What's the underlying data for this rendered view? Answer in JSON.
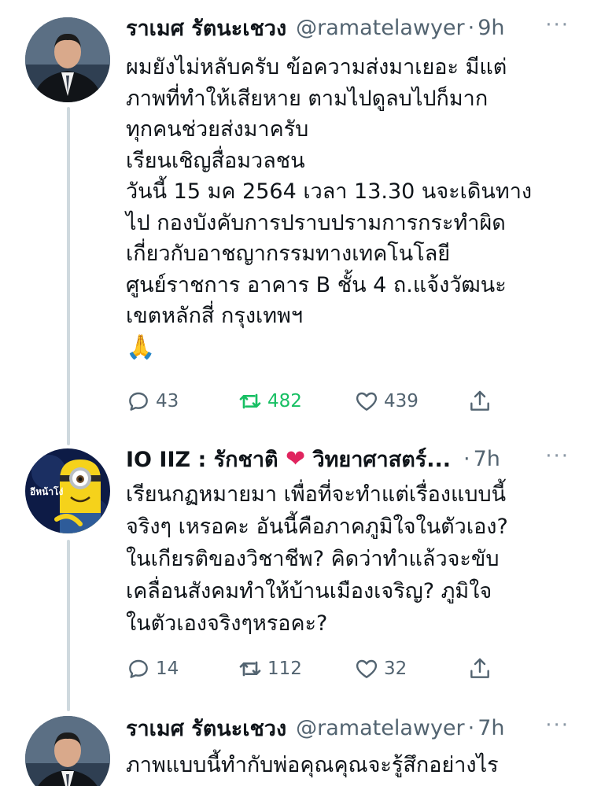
{
  "tweets": [
    {
      "name": "ราเมศ รัตนะเชวง",
      "handle": "@ramatelawyer",
      "separator": "·",
      "time": "9h",
      "more": "···",
      "lines": [
        "ผมยังไม่หลับครับ ข้อความส่งมาเยอะ มีแต่",
        "ภาพที่ทำให้เสียหาย ตามไปดูลบไปก็มาก",
        "ทุกคนช่วยส่งมาครับ",
        "เรียนเชิญสื่อมวลชน",
        "วันนี้ 15 มค 2564 เวลา 13.30 นจะเดินทาง",
        "ไป กองบังคับการปราบปรามการกระทำผิด",
        "เกี่ยวกับอาชญากรรมทางเทคโนโลยี",
        "ศูนย์ราชการ อาคาร B ชั้น 4 ถ.แจ้งวัฒนะ",
        "เขตหลักสี่ กรุงเทพฯ",
        "🙏"
      ],
      "replies": "43",
      "retweets": "482",
      "likes": "439"
    },
    {
      "name": "IO IIZ : รักชาติ ❤️ วิทยาศาสตร์...",
      "handle": "",
      "separator": "·",
      "time": "7h",
      "more": "···",
      "avatar_text": "อีหน้าโง่",
      "lines": [
        "เรียนกฏหมายมา เพื่อที่จะทำแต่เรื่องแบบนี้",
        "จริงๆ เหรอคะ อันนี้คือภาคภูมิใจในตัวเอง?",
        "ในเกียรติของวิชาชีพ? คิดว่าทำแล้วจะขับ",
        "เคลื่อนสังคมทำให้บ้านเมืองเจริญ? ภูมิใจ",
        "ในตัวเองจริงๆหรอคะ?"
      ],
      "replies": "14",
      "retweets": "112",
      "likes": "32"
    },
    {
      "name": "ราเมศ รัตนะเชวง",
      "handle": "@ramatelawyer",
      "separator": "·",
      "time": "7h",
      "more": "···",
      "lines": [
        "ภาพแบบนี้ทำกับพ่อคุณคุณจะรู้สึกอย่างไร"
      ]
    }
  ],
  "icons": {
    "reply": "reply-icon",
    "retweet": "retweet-icon",
    "like": "heart-icon",
    "share": "share-icon"
  },
  "colors": {
    "text": "#0f1419",
    "secondary": "#536471",
    "retweet_active": "#17bf63",
    "thread_line": "#cfd9de"
  }
}
